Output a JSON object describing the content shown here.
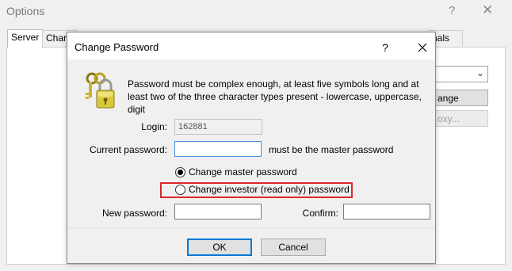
{
  "options_window": {
    "title": "Options",
    "help_glyph": "?",
    "close_glyph": "✕",
    "tabs": [
      "Server",
      "Charts",
      "nals"
    ],
    "change_button": "ange",
    "proxy_button": "oxy...",
    "dropdown_arrow": "⌄"
  },
  "dialog": {
    "title": "Change Password",
    "help_glyph": "?",
    "icon": "keys-lock-icon",
    "info_text": "Password must be complex enough, at least five symbols long and at least two of the three character types present - lowercase, uppercase, digit",
    "login_label": "Login:",
    "login_value": "162881",
    "current_password_label": "Current password:",
    "current_password_value": "",
    "master_note": "must be the master password",
    "radio_master_label": "Change master password",
    "radio_master_checked": true,
    "radio_investor_label": "Change investor (read only) password",
    "radio_investor_checked": false,
    "new_password_label": "New password:",
    "new_password_value": "",
    "confirm_label": "Confirm:",
    "confirm_value": "",
    "ok_label": "OK",
    "cancel_label": "Cancel"
  },
  "colors": {
    "highlight": "#d9292b",
    "focus": "#0078d7"
  }
}
